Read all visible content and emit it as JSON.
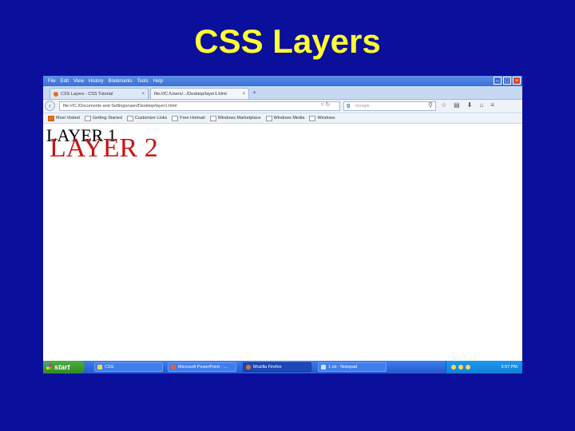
{
  "slide": {
    "title": "CSS Layers"
  },
  "browser": {
    "menu": [
      "File",
      "Edit",
      "View",
      "History",
      "Bookmarks",
      "Tools",
      "Help"
    ],
    "tabs": [
      {
        "label": "CSS Layers - CSS Tutorial"
      },
      {
        "label": "file:///C:/Users/.../Desktop/layer1.html"
      }
    ],
    "url": "file:///C:/Documents and Settings/user/Desktop/layer1.html",
    "search_placeholder": "Google",
    "bookmarks": [
      "Most Visited",
      "Getting Started",
      "Customize Links",
      "Free Hotmail",
      "Windows Marketplace",
      "Windows Media",
      "Windows"
    ]
  },
  "page": {
    "layer1": "LAYER 1",
    "layer2": "LAYER 2"
  },
  "taskbar": {
    "start_label": "start",
    "tasks": [
      "CSS",
      "Microsoft PowerPoint - ...",
      "Mozilla Firefox",
      "1.txt - Notepad"
    ],
    "clock": "3:57 PM"
  },
  "colors": {
    "slide_background": "#0a0f9c",
    "slide_title": "#ffff33",
    "layer2_text": "#cc1111"
  }
}
